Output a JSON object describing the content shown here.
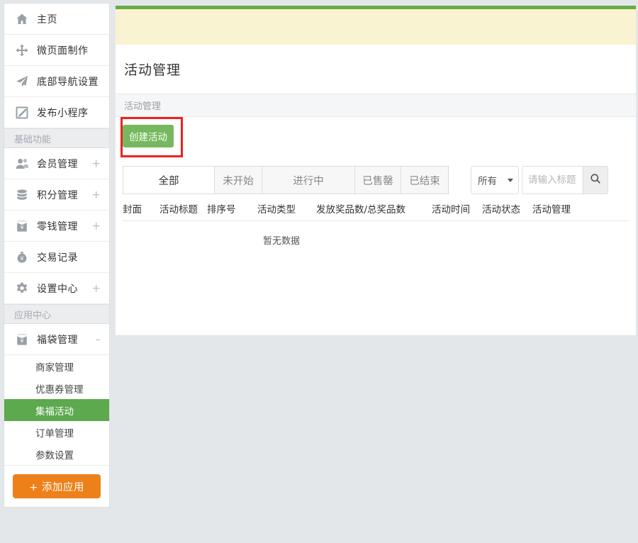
{
  "sidebar": {
    "primary_items": [
      {
        "label": "主页",
        "icon": "home-icon",
        "expandable": false
      },
      {
        "label": "微页面制作",
        "icon": "move-arrows-icon",
        "expandable": false
      },
      {
        "label": "底部导航设置",
        "icon": "paper-plane-icon",
        "expandable": false
      },
      {
        "label": "发布小程序",
        "icon": "edit-square-icon",
        "expandable": false
      }
    ],
    "section_basic": "基础功能",
    "basic_items": [
      {
        "label": "会员管理",
        "icon": "users-icon",
        "expand_symbol": "+"
      },
      {
        "label": "积分管理",
        "icon": "database-icon",
        "expand_symbol": "+"
      },
      {
        "label": "零钱管理",
        "icon": "red-envelope-icon",
        "expand_symbol": "+"
      },
      {
        "label": "交易记录",
        "icon": "money-bag-icon",
        "expand_symbol": ""
      },
      {
        "label": "设置中心",
        "icon": "gear-icon",
        "expand_symbol": "+"
      }
    ],
    "section_app": "应用中心",
    "app_group": {
      "label": "福袋管理",
      "icon": "red-envelope-icon",
      "collapse_symbol": "–",
      "children": [
        {
          "label": "商家管理",
          "active": false
        },
        {
          "label": "优惠券管理",
          "active": false
        },
        {
          "label": "集福活动",
          "active": true
        },
        {
          "label": "订单管理",
          "active": false
        },
        {
          "label": "参数设置",
          "active": false
        }
      ]
    },
    "add_app_label": "+ 添加应用"
  },
  "main": {
    "page_title": "活动管理",
    "breadcrumb": "活动管理",
    "create_button": "创建活动",
    "tabs": [
      {
        "label": "全部",
        "active": true
      },
      {
        "label": "未开始",
        "active": false
      },
      {
        "label": "进行中",
        "active": false
      },
      {
        "label": "已售罄",
        "active": false
      },
      {
        "label": "已结束",
        "active": false
      }
    ],
    "filter": {
      "select_value": "所有",
      "search_placeholder": "请输入标题",
      "search_value": "",
      "search_icon": "search-icon"
    },
    "table": {
      "columns": [
        "封面",
        "活动标题",
        "排序号",
        "活动类型",
        "发放奖品数/总奖品数",
        "活动时间",
        "活动状态",
        "活动管理"
      ],
      "rows": [],
      "empty_text": "暂无数据"
    }
  },
  "colors": {
    "accent_green": "#5ca94e",
    "top_bar_green": "#68ab45",
    "button_green": "#76b85e",
    "banner_cream": "#faf3d2",
    "orange": "#ed8018",
    "highlight_red": "#f02020",
    "page_bg": "#e4e7ea"
  }
}
